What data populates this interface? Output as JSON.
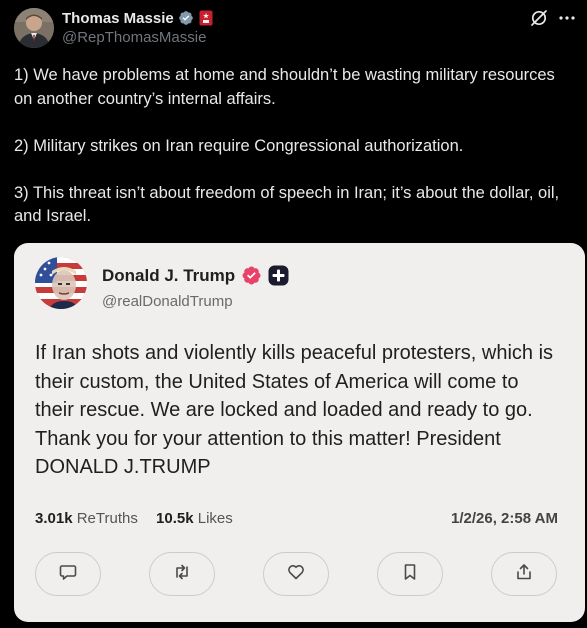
{
  "post": {
    "author_name": "Thomas Massie",
    "author_handle": "@RepThomasMassie",
    "paragraphs": [
      "1) We have problems at home and shouldn’t be wasting military resources on another country’s internal affairs.",
      "2) Military strikes on Iran require Congressional authorization.",
      "3) This threat isn’t about freedom of speech in Iran; it’s about the dollar, oil, and Israel."
    ],
    "icons": [
      "verified-badge-icon",
      "government-badge-icon",
      "grok-icon",
      "more-icon"
    ]
  },
  "quoted": {
    "author_name": "Donald J. Trump",
    "author_handle": "@realDonaldTrump",
    "text": "If Iran shots and violently kills peaceful protesters, which is their custom, the United States of America will come to their rescue. We are locked and loaded and ready to go. Thank you for your attention to this matter! President DONALD J.TRUMP",
    "retruths_count": "3.01k",
    "retruths_label": "ReTruths",
    "likes_count": "10.5k",
    "likes_label": "Likes",
    "date": "1/2/26, 2:58 AM",
    "actions": [
      "reply-icon",
      "retruth-icon",
      "like-icon",
      "bookmark-icon",
      "share-icon"
    ]
  },
  "colors": {
    "background": "#000000",
    "text": "#e7e9ea",
    "secondary_text": "#71767b",
    "verified_blue": "#1d9bf0",
    "card_background": "#f1efed",
    "truth_verified": "#e8416a"
  }
}
